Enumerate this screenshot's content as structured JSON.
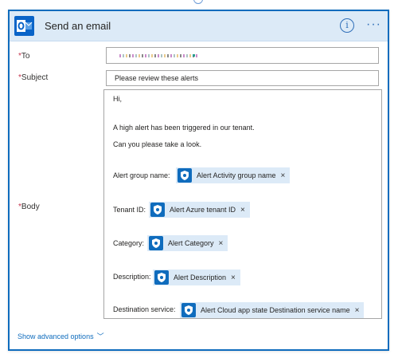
{
  "card": {
    "title": "Send an email",
    "info_icon": "info-icon",
    "more_icon": "more-options-icon",
    "brand_color": "#0f6cbd",
    "header_bg": "#dceaf7"
  },
  "fields": {
    "to_label": "To",
    "subject_label": "Subject",
    "subject_value": "Please review these alerts",
    "body_label": "Body",
    "required_marker": "*"
  },
  "body": {
    "greeting": "Hi,",
    "line1": "A high alert has been triggered in our tenant.",
    "line2": "Can you please take a look.",
    "rows": [
      {
        "label": "Alert group name:",
        "token": "Alert Activity group name"
      },
      {
        "label": "Tenant ID:",
        "token": "Alert Azure tenant ID"
      },
      {
        "label": "Category:",
        "token": "Alert Category"
      },
      {
        "label": "Description:",
        "token": "Alert Description"
      },
      {
        "label": "Destination service:",
        "token": "Alert Cloud app state Destination service name"
      }
    ],
    "remove_glyph": "×"
  },
  "advanced": {
    "label": "Show advanced options",
    "chevron": "﹀"
  }
}
